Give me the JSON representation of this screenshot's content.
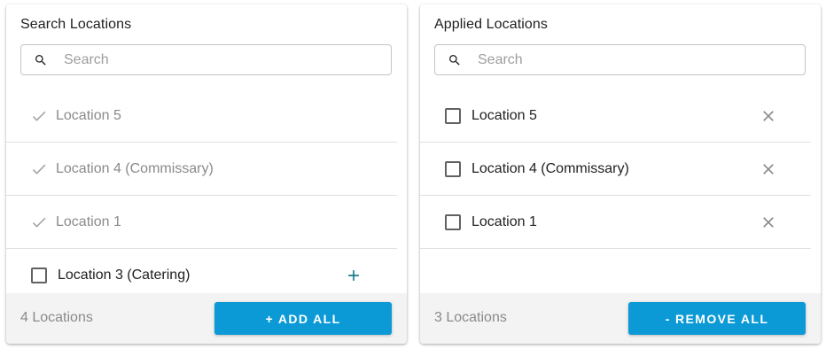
{
  "colors": {
    "accent": "#0b9ad6",
    "add_icon": "#1a7a8c",
    "muted_text": "#8a8a8a",
    "footer_bg": "#f3f3f3"
  },
  "search_panel": {
    "title": "Search Locations",
    "search": {
      "placeholder": "Search",
      "value": ""
    },
    "items": [
      {
        "label": "Location 5",
        "state": "added",
        "icon": "check-icon"
      },
      {
        "label": "Location 4 (Commissary)",
        "state": "added",
        "icon": "check-icon"
      },
      {
        "label": "Location 1",
        "state": "added",
        "icon": "check-icon"
      },
      {
        "label": "Location 3 (Catering)",
        "state": "available",
        "icon": "checkbox",
        "action_icon": "plus-icon"
      }
    ],
    "footer": {
      "count_label": "4 Locations",
      "action_label": "+ ADD ALL"
    }
  },
  "applied_panel": {
    "title": "Applied Locations",
    "search": {
      "placeholder": "Search",
      "value": ""
    },
    "items": [
      {
        "label": "Location 5",
        "checked": false,
        "action_icon": "close-icon"
      },
      {
        "label": "Location 4 (Commissary)",
        "checked": false,
        "action_icon": "close-icon"
      },
      {
        "label": "Location 1",
        "checked": false,
        "action_icon": "close-icon"
      }
    ],
    "footer": {
      "count_label": "3 Locations",
      "action_label": "- REMOVE ALL"
    }
  }
}
